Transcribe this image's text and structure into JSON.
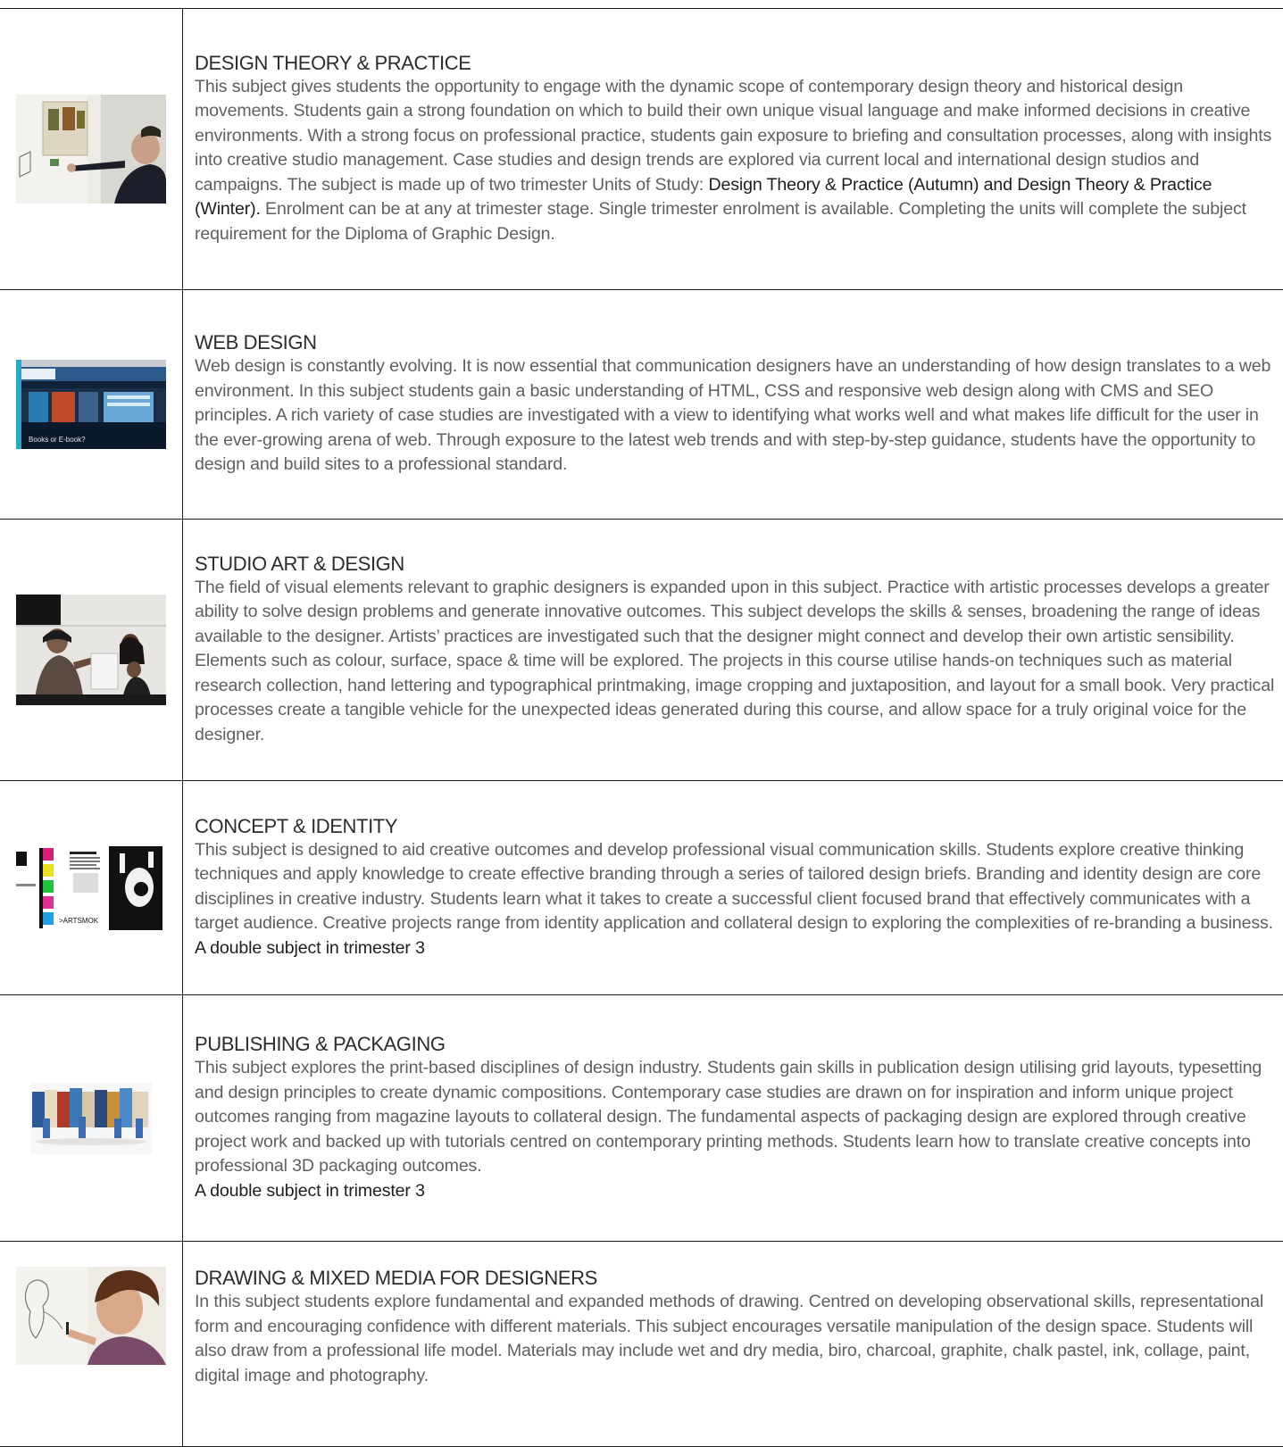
{
  "subjects": [
    {
      "image": "studio-presentation-photo",
      "title": "DESIGN THEORY & PRACTICE",
      "description_a": "This subject gives students the opportunity to engage with the dynamic scope of contemporary design theory and historical design movements. Students gain a strong foundation on which to build their own unique visual language and make informed decisions in creative environments.  With a strong focus on professional practice, students gain exposure to briefing and consultation processes, along with insights into creative studio management. Case studies and design trends are explored via current local and international design studios and campaigns.  The subject is made up of two trimester Units of Study: ",
      "description_bold": "Design Theory & Practice (Autumn) and Design Theory & Practice (Winter).",
      "description_b": " Enrolment can be at any at trimester stage. Single trimester enrolment is available. Completing the units will complete the subject requirement for the Diploma of Graphic Design."
    },
    {
      "image": "website-screenshot",
      "title": "WEB DESIGN",
      "description": "Web design is constantly evolving. It is now essential that communication designers have an understanding of how design translates to a web environment. In this subject students gain a basic understanding of HTML, CSS and responsive web design along with CMS and SEO principles.  A rich variety of case studies are investigated with a view to identifying what works well and what makes life difficult for the user in the ever-growing arena of web. Through exposure to the latest web trends and with step-by-step guidance, students have the opportunity to design and build sites to a professional standard.",
      "thumb_text": "Books or E-book?"
    },
    {
      "image": "classroom-photo",
      "title": "STUDIO ART & DESIGN",
      "description": "The field of visual elements relevant to graphic designers is expanded upon in this subject. Practice with artistic processes develops a greater ability to solve design problems and generate innovative outcomes. This subject develops the skills & senses, broadening the range of ideas available to the designer. Artists’ practices are investigated such that the designer might connect and develop their own artistic sensibility. Elements such as colour, surface, space & time will be explored. The projects in this course utilise hands-on techniques such as material research collection, hand lettering and typographical printmaking, image cropping and juxtaposition, and layout for a small book. Very practical processes create a tangible vehicle for the unexpected ideas generated during this course, and allow space for a truly original voice for the designer."
    },
    {
      "image": "branding-artwork",
      "title": "CONCEPT & IDENTITY",
      "description": "This subject is designed to aid creative outcomes and develop professional visual communication skills. Students explore creative thinking techniques and apply knowledge to create effective branding through a series of tailored design briefs. Branding and identity design are core disciplines in creative industry. Students learn what it takes to create a successful client focused brand that effectively communicates with a target audience. Creative projects range from identity application and collateral design to exploring the complexities of re-branding a business.",
      "note": "A double subject in trimester 3",
      "thumb_text": ">ARTSMOK"
    },
    {
      "image": "packaging-photo",
      "title": "PUBLISHING & PACKAGING",
      "description": "This subject explores the print-based disciplines of design industry. Students gain skills in publication design utilising grid layouts, typesetting and design principles to create dynamic compositions. Contemporary case studies are drawn on for inspiration and inform unique project outcomes ranging from magazine layouts to collateral design. The fundamental aspects of packaging design are explored through creative project work and backed up with tutorials centred on contemporary printing methods. Students learn how to translate creative concepts into professional 3D packaging outcomes.",
      "note": "A double subject in trimester 3"
    },
    {
      "image": "drawing-student-photo",
      "title": "DRAWING & MIXED MEDIA FOR DESIGNERS",
      "description": "In this subject students explore fundamental and expanded methods of drawing. Centred on developing observational skills, representational form and encouraging confidence with different materials. This subject encourages versatile manipulation of the design space. Students will also draw from a professional life model. Materials may include wet and dry media, biro, charcoal, graphite, chalk pastel, ink, collage, paint, digital image and photography."
    }
  ]
}
